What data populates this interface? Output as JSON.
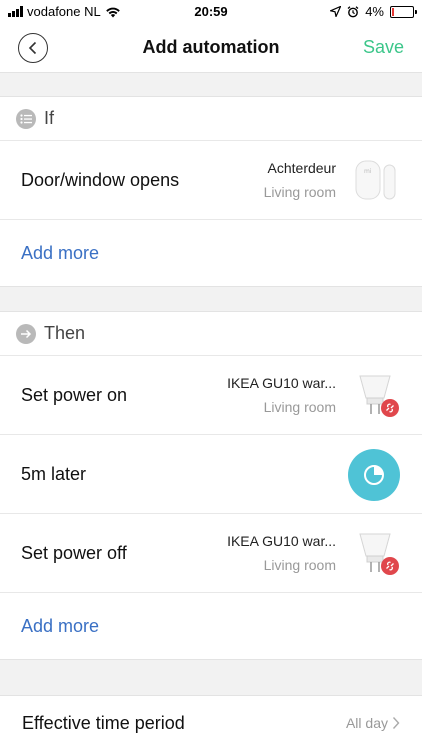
{
  "status_bar": {
    "carrier": "vodafone NL",
    "time": "20:59",
    "battery": "4%",
    "battery_level": 0.04,
    "battery_color": "#e53935"
  },
  "nav": {
    "title": "Add automation",
    "save": "Save",
    "save_color": "#3cc68a"
  },
  "if_section": {
    "header": "If",
    "conditions": [
      {
        "label": "Door/window opens",
        "device": "Achterdeur",
        "room": "Living room",
        "icon": "door-sensor-icon"
      }
    ],
    "add_more": "Add more"
  },
  "then_section": {
    "header": "Then",
    "actions": [
      {
        "label": "Set power on",
        "device": "IKEA GU10 war...",
        "room": "Living room",
        "icon": "bulb-icon"
      },
      {
        "label": "5m later",
        "icon": "timer-icon"
      },
      {
        "label": "Set power off",
        "device": "IKEA GU10 war...",
        "room": "Living room",
        "icon": "bulb-icon"
      }
    ],
    "add_more": "Add more"
  },
  "effective": {
    "label": "Effective time period",
    "value": "All day"
  },
  "colors": {
    "link": "#3a70c4",
    "timer_bg": "#4fc3d6",
    "offline_badge": "#e0474c"
  }
}
